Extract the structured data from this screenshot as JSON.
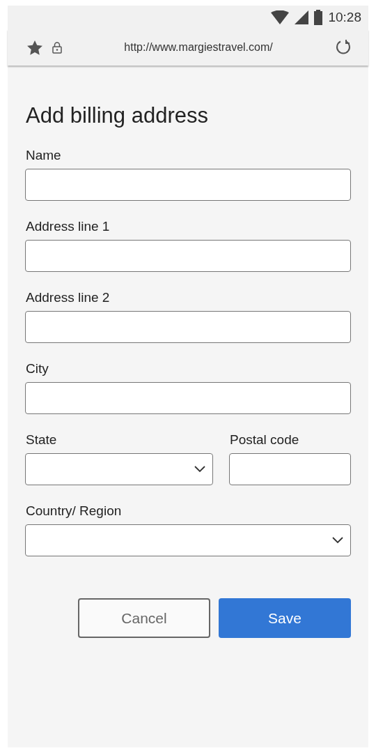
{
  "status_bar": {
    "time": "10:28"
  },
  "browser_bar": {
    "url": "http://www.margiestravel.com/"
  },
  "form": {
    "title": "Add billing address",
    "fields": [
      {
        "label": "Name",
        "kind": "text"
      },
      {
        "label": "Address line 1",
        "kind": "text"
      },
      {
        "label": "Address line 2",
        "kind": "text"
      },
      {
        "label": "City",
        "kind": "text"
      }
    ],
    "row_fields": [
      {
        "label": "State",
        "kind": "select"
      },
      {
        "label": "Postal code",
        "kind": "text"
      }
    ],
    "country": {
      "label": "Country/ Region",
      "kind": "select"
    },
    "buttons": [
      {
        "label": "Cancel",
        "kind": "secondary"
      },
      {
        "label": "Save",
        "kind": "primary"
      }
    ]
  }
}
